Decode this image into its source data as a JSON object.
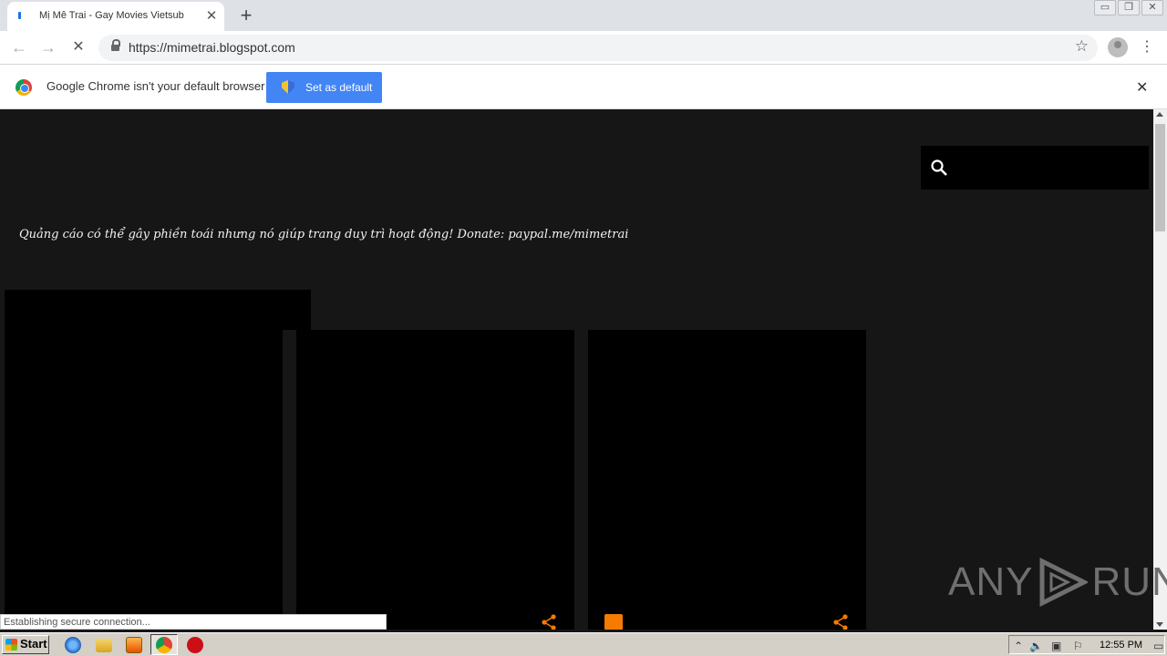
{
  "browser": {
    "tab": {
      "title": "Mị Mê Trai - Gay Movies Vietsub",
      "close_glyph": "✕"
    },
    "new_tab_glyph": "+",
    "window_buttons": [
      "▭",
      "❐",
      "✕"
    ],
    "nav": {
      "back": "←",
      "forward": "→",
      "reload": "✕"
    },
    "url": "https://mimetrai.blogspot.com",
    "bookmark_glyph": "☆",
    "menu_glyph": "⋮"
  },
  "infobar": {
    "message": "Google Chrome isn't your default browser",
    "button_label": "Set as default",
    "close_glyph": "✕"
  },
  "page": {
    "notice": "Quảng cáo có thể gây phiền toái nhưng nó giúp trang duy trì hoạt động! Donate: paypal.me/mimetrai"
  },
  "status_bar": {
    "text": "Establishing secure connection..."
  },
  "watermark": {
    "left": "ANY",
    "right": "RUN"
  },
  "taskbar": {
    "start_label": "Start",
    "clock": "12:55 PM"
  },
  "colors": {
    "page_bg": "#161616",
    "accent_orange": "#f57c00",
    "button_blue": "#4285f4"
  }
}
